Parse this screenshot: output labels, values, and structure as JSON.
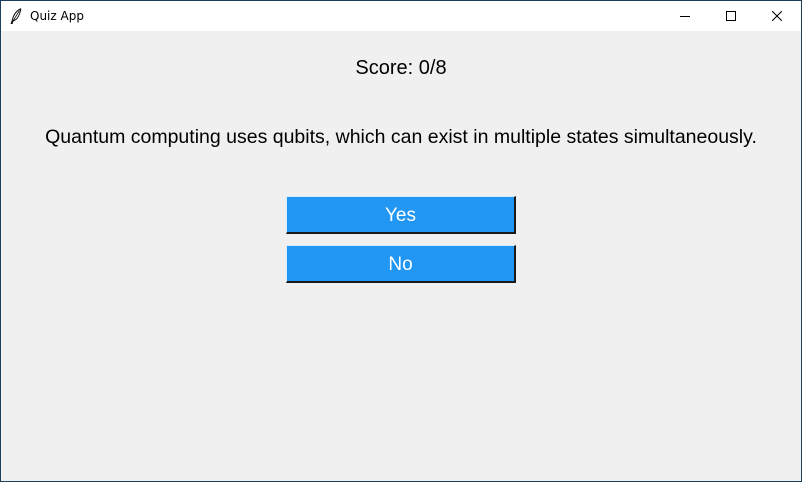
{
  "window": {
    "title": "Quiz App",
    "app_icon": "feather-icon"
  },
  "controls": {
    "minimize_icon": "minimize-icon",
    "maximize_icon": "maximize-icon",
    "close_icon": "close-icon"
  },
  "quiz": {
    "score": "Score: 0/8",
    "question": "Quantum computing uses qubits, which can exist in multiple states simultaneously.",
    "yes_label": "Yes",
    "no_label": "No"
  },
  "colors": {
    "button_bg": "#2196f3",
    "button_text": "#ffffff",
    "client_bg": "#f0f0f0"
  }
}
